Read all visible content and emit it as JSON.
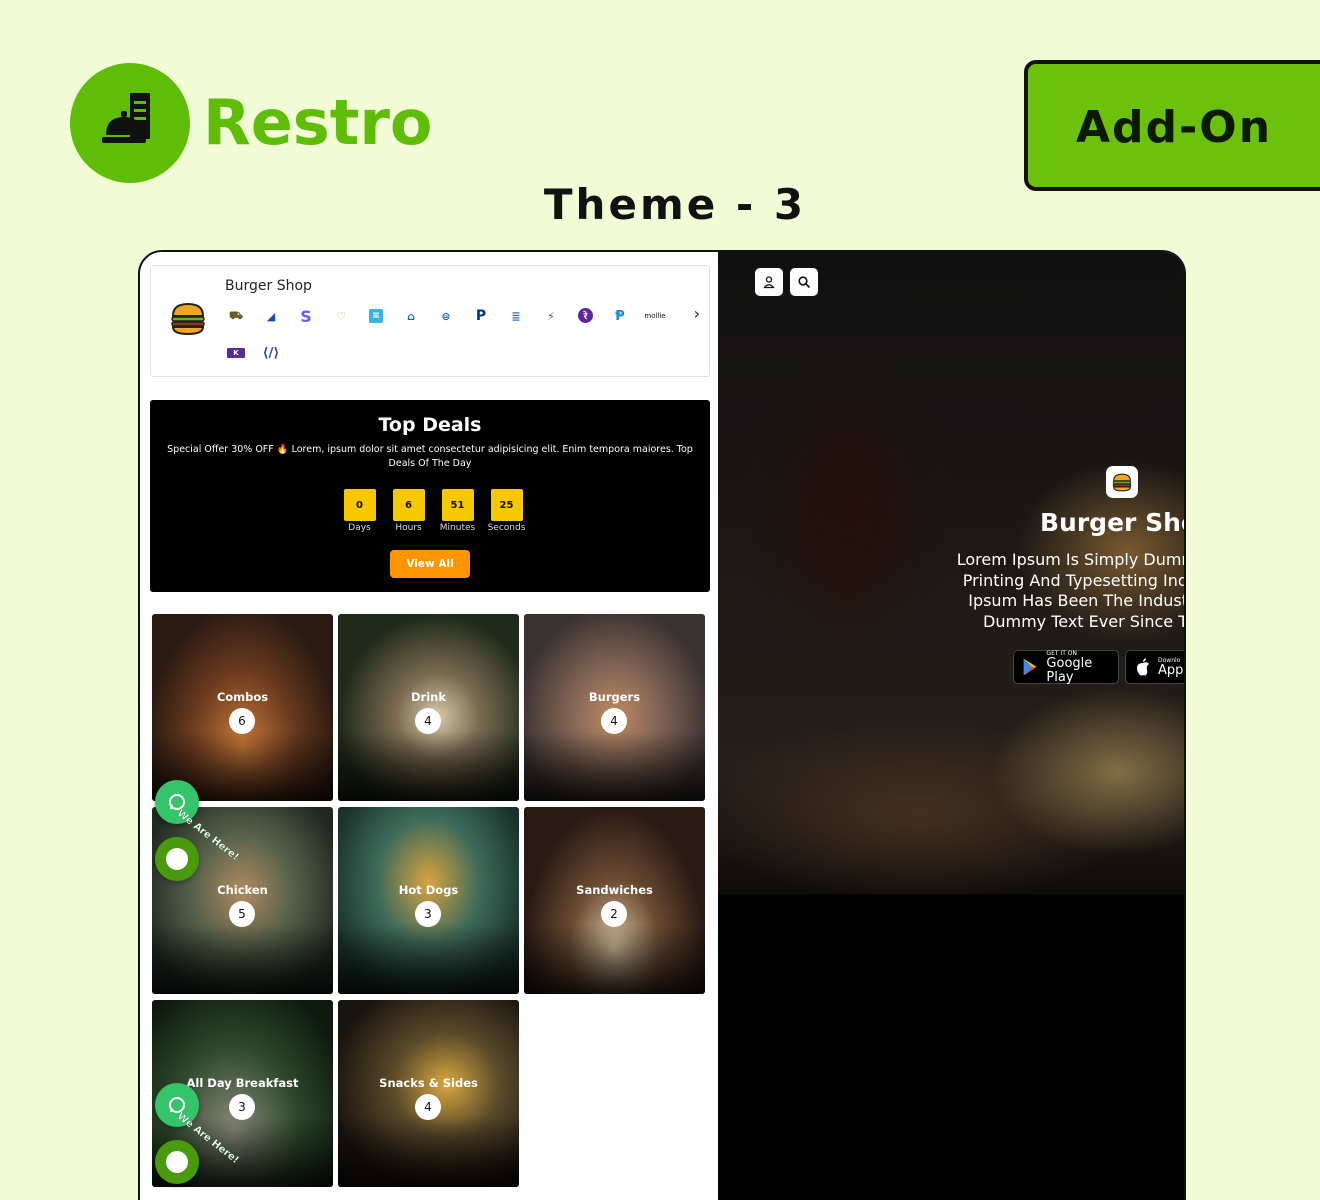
{
  "brand": {
    "name": "Restro",
    "accent": "#5fbd08"
  },
  "badge": {
    "label": "Add-On"
  },
  "theme_title": "Theme - 3",
  "shop": {
    "name": "Burger Shop",
    "payment_icons": [
      "deliveroo-icon",
      "razorpay-icon",
      "stripe-icon",
      "flutterwave-icon",
      "paystack-icon",
      "mercado-icon",
      "paytabs-icon",
      "paypal-icon",
      "skrill-icon",
      "payfast-icon",
      "phonepe-icon",
      "paiement-pro-icon",
      "mollie-icon",
      "khalti-icon",
      "midtrans-icon"
    ],
    "mollie_text": "mollie"
  },
  "deals": {
    "title": "Top Deals",
    "description": "Special Offer 30% OFF 🔥 Lorem, ipsum dolor sit amet consectetur adipisicing elit. Enim tempora maiores. Top Deals Of The Day",
    "countdown": [
      {
        "value": "0",
        "label": "Days"
      },
      {
        "value": "6",
        "label": "Hours"
      },
      {
        "value": "51",
        "label": "Minutes"
      },
      {
        "value": "25",
        "label": "Seconds"
      }
    ],
    "view_all": "View All"
  },
  "categories": [
    {
      "name": "Combos",
      "count": "6"
    },
    {
      "name": "Drink",
      "count": "4"
    },
    {
      "name": "Burgers",
      "count": "4"
    },
    {
      "name": "Chicken",
      "count": "5"
    },
    {
      "name": "Hot Dogs",
      "count": "3"
    },
    {
      "name": "Sandwiches",
      "count": "2"
    },
    {
      "name": "All Day Breakfast",
      "count": "3"
    },
    {
      "name": "Snacks & Sides",
      "count": "4"
    }
  ],
  "floating": {
    "here_text": "We Are Here!"
  },
  "hero": {
    "shop_name": "Burger Sho",
    "description_lines": [
      "Lorem Ipsum Is Simply Dumr",
      "Printing And Typesetting Ind",
      "Ipsum Has Been The Indust",
      "Dummy Text Ever Since T"
    ],
    "google_play": {
      "small": "GET IT ON",
      "big": "Google Play"
    },
    "app_store": {
      "small": "Downlo",
      "big": "App"
    }
  }
}
